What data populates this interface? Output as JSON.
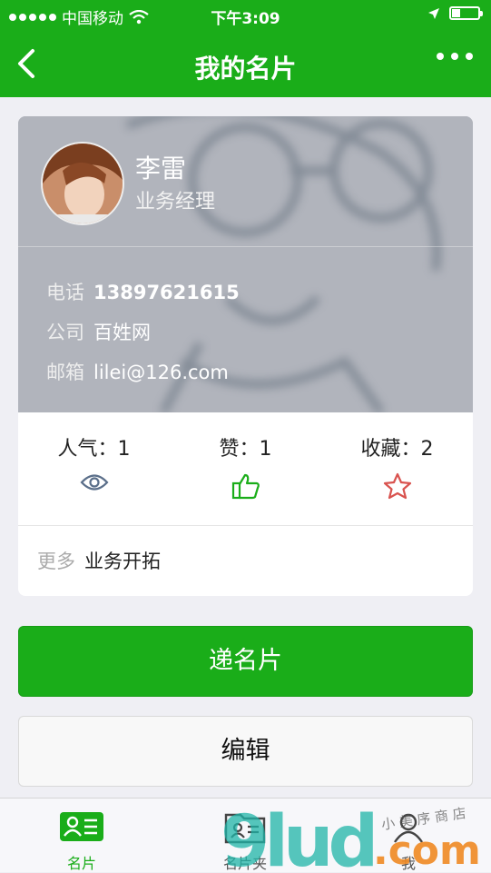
{
  "status_bar": {
    "carrier": "中国移动",
    "time": "下午3:09"
  },
  "nav": {
    "title": "我的名片"
  },
  "card": {
    "name": "李雷",
    "title": "业务经理",
    "phone": {
      "label": "电话",
      "value": "13897621615"
    },
    "company": {
      "label": "公司",
      "value": "百姓网"
    },
    "email": {
      "label": "邮箱",
      "value": "lilei@126.com"
    },
    "stats": [
      {
        "label": "人气：",
        "value": "1",
        "icon": "eye-icon"
      },
      {
        "label": "赞：",
        "value": "1",
        "icon": "thumbs-up-icon"
      },
      {
        "label": "收藏：",
        "value": "2",
        "icon": "star-icon"
      }
    ],
    "more": {
      "label": "更多",
      "value": "业务开拓"
    }
  },
  "buttons": {
    "send_card": "递名片",
    "edit": "编辑"
  },
  "tabbar": {
    "items": [
      {
        "label": "名片",
        "icon": "card-icon",
        "active": true
      },
      {
        "label": "名片夹",
        "icon": "card-folder-icon",
        "active": false
      },
      {
        "label": "我",
        "icon": "person-icon",
        "active": false
      }
    ]
  },
  "watermark": {
    "text": "9lud.com",
    "subtext": "小 美 序 商 店"
  },
  "colors": {
    "brand_green": "#1aad19",
    "star_red": "#d9534f",
    "eye_gray": "#5b6f8a"
  }
}
